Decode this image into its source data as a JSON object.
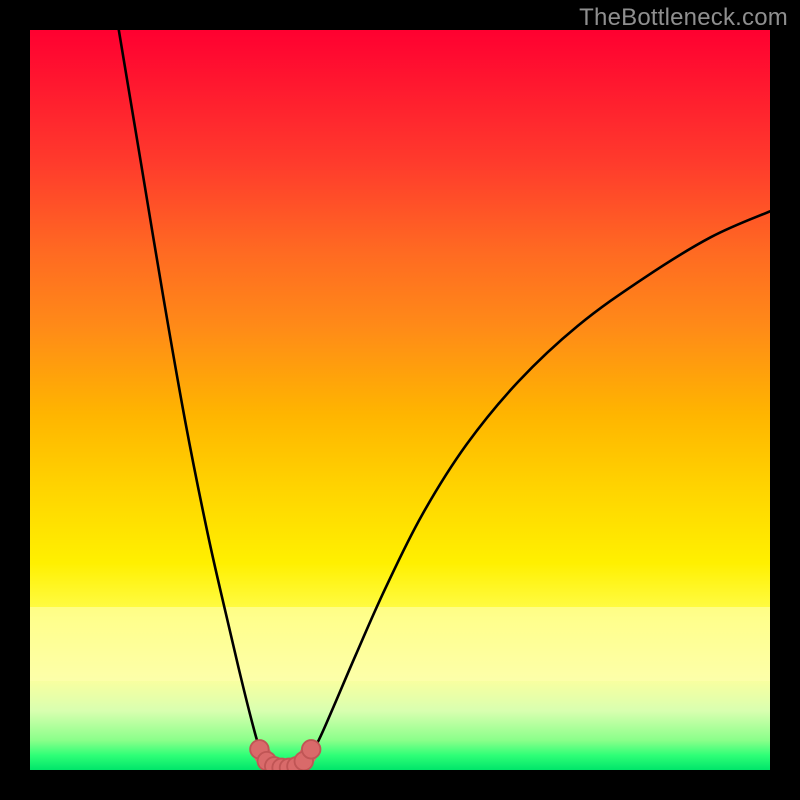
{
  "watermark": "TheBottleneck.com",
  "colors": {
    "page_bg": "#000000",
    "curve": "#000000",
    "marker_fill": "#d96a6a",
    "marker_stroke": "#c05555",
    "gradient_stops": [
      "#ff0030",
      "#ff1a2f",
      "#ff3b2c",
      "#ff6a22",
      "#ff8a18",
      "#ffb500",
      "#ffd400",
      "#fff000",
      "#ffff57",
      "#f8ffa0",
      "#d9ffb0",
      "#8aff8a",
      "#2fff77",
      "#00e56a"
    ]
  },
  "chart_data": {
    "type": "line",
    "title": "",
    "xlabel": "",
    "ylabel": "",
    "xlim": [
      0,
      100
    ],
    "ylim": [
      0,
      100
    ],
    "grid": false,
    "legend": false,
    "series": [
      {
        "name": "left-branch",
        "x": [
          12.0,
          15.0,
          18.0,
          21.0,
          24.0,
          26.5,
          28.5,
          30.0,
          31.0,
          32.0,
          32.8
        ],
        "y": [
          100.0,
          82.0,
          64.0,
          47.0,
          32.0,
          21.0,
          12.5,
          6.5,
          3.0,
          1.0,
          0.3
        ]
      },
      {
        "name": "right-branch",
        "x": [
          36.2,
          37.5,
          39.0,
          41.0,
          44.0,
          48.0,
          53.0,
          59.0,
          66.0,
          74.0,
          83.0,
          92.0,
          100.0
        ],
        "y": [
          0.3,
          1.5,
          4.0,
          8.5,
          15.5,
          24.5,
          34.5,
          44.0,
          52.5,
          60.0,
          66.5,
          72.0,
          75.5
        ]
      },
      {
        "name": "trough-markers",
        "x": [
          31.0,
          32.0,
          33.0,
          34.0,
          35.0,
          36.0,
          37.0,
          38.0
        ],
        "y": [
          2.8,
          1.2,
          0.5,
          0.3,
          0.3,
          0.5,
          1.2,
          2.8
        ]
      }
    ],
    "annotations": [
      {
        "text": "TheBottleneck.com",
        "position": "top-right"
      }
    ]
  }
}
